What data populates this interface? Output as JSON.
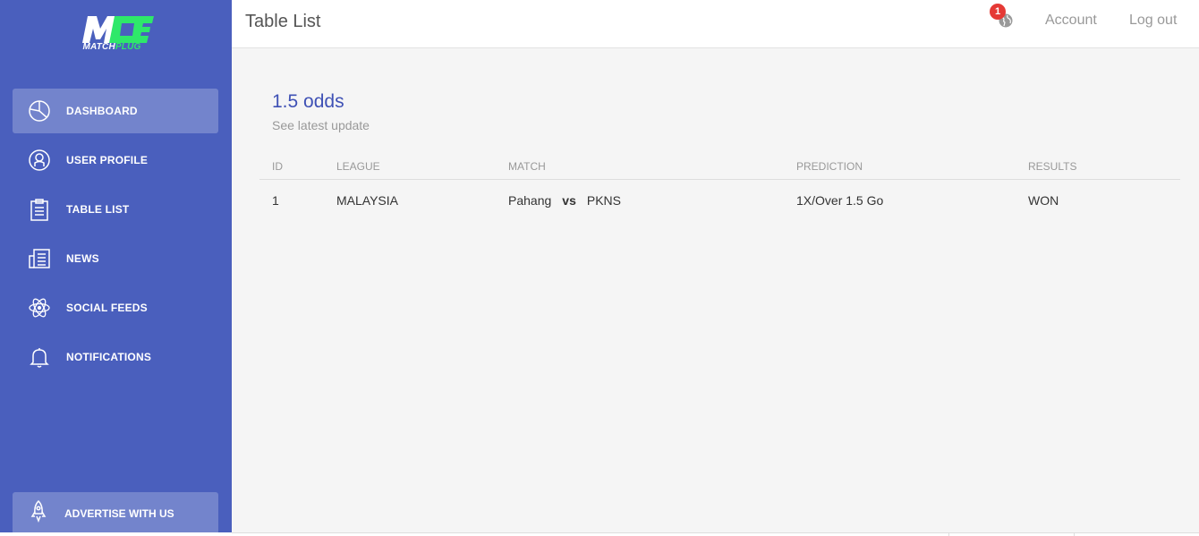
{
  "brand": {
    "logo_text": "MATCH",
    "logo_text_accent": "PLUG",
    "logo_colors": {
      "primary": "#ffffff",
      "accent": "#2ee86a"
    }
  },
  "sidebar": {
    "background": "#4a5fbd",
    "items": [
      {
        "label": "DASHBOARD",
        "icon": "pie-chart-icon",
        "active": true
      },
      {
        "label": "USER PROFILE",
        "icon": "user-circle-icon",
        "active": false
      },
      {
        "label": "TABLE LIST",
        "icon": "clipboard-icon",
        "active": false
      },
      {
        "label": "NEWS",
        "icon": "newspaper-icon",
        "active": false
      },
      {
        "label": "SOCIAL FEEDS",
        "icon": "atom-icon",
        "active": false
      },
      {
        "label": "NOTIFICATIONS",
        "icon": "bell-icon",
        "active": false
      }
    ],
    "advertise": {
      "label": "ADVERTISE WITH US",
      "icon": "rocket-icon"
    }
  },
  "header": {
    "title": "Table List",
    "notification_count": "1",
    "account_label": "Account",
    "logout_label": "Log out"
  },
  "card": {
    "title": "1.5 odds",
    "subtitle": "See latest update"
  },
  "table": {
    "headers": [
      "ID",
      "LEAGUE",
      "MATCH",
      "PREDICTION",
      "RESULTS"
    ],
    "rows": [
      {
        "id": "1",
        "league": "MALAYSIA",
        "home": "Pahang",
        "vs": "vs",
        "away": "PKNS",
        "prediction": "1X/Over 1.5 Go",
        "result": "WON"
      }
    ]
  }
}
